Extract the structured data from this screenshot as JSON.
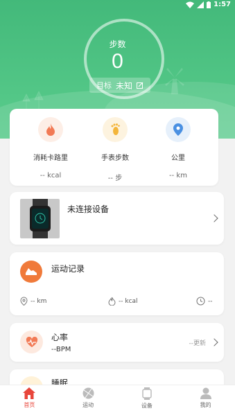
{
  "status_bar": {
    "time": "1:57",
    "icons": [
      "wifi-icon",
      "signal-icon",
      "battery-icon"
    ]
  },
  "hero": {
    "steps_label": "步数",
    "steps_value": "0",
    "goal_label": "目标",
    "goal_value": "未知",
    "colors": {
      "gradient_top": "#43b97a",
      "gradient_bottom": "#5bcb8d"
    }
  },
  "stats": [
    {
      "icon": "flame-icon",
      "name": "消耗卡路里",
      "value": "-- kcal",
      "color": "#f27a55"
    },
    {
      "icon": "footprint-icon",
      "name": "手表步数",
      "value": "-- 步",
      "color": "#f3b53a"
    },
    {
      "icon": "location-pin-icon",
      "name": "公里",
      "value": "-- km",
      "color": "#4a90e2"
    }
  ],
  "device": {
    "label": "未连接设备"
  },
  "record": {
    "title": "运动记录",
    "distance": "-- km",
    "calories": "-- kcal",
    "duration": "--"
  },
  "heart_rate": {
    "title": "心率",
    "value": "--BPM",
    "update_label": "--更新"
  },
  "sleep": {
    "title": "睡眠"
  },
  "tabs": [
    {
      "label": "首页",
      "icon": "home-icon",
      "active": true
    },
    {
      "label": "运动",
      "icon": "ball-icon",
      "active": false
    },
    {
      "label": "设备",
      "icon": "watch-icon",
      "active": false
    },
    {
      "label": "我的",
      "icon": "user-icon",
      "active": false
    }
  ],
  "accent_color": "#e8463b"
}
